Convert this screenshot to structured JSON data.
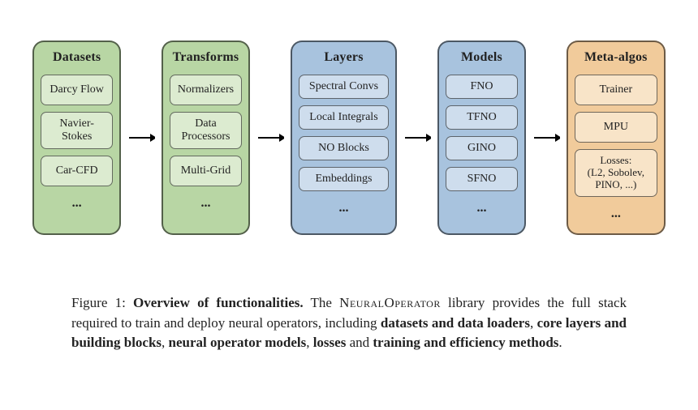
{
  "chart_data": {
    "type": "diagram",
    "flow": [
      "Datasets",
      "Transforms",
      "Layers",
      "Models",
      "Meta-algos"
    ],
    "columns": [
      {
        "title": "Datasets",
        "color": "green",
        "items": [
          "Darcy Flow",
          "Navier-Stokes",
          "Car-CFD"
        ],
        "more": "..."
      },
      {
        "title": "Transforms",
        "color": "green",
        "items": [
          "Normalizers",
          "Data Processors",
          "Multi-Grid"
        ],
        "more": "..."
      },
      {
        "title": "Layers",
        "color": "blue",
        "items": [
          "Spectral Convs",
          "Local Integrals",
          "NO Blocks",
          "Embeddings"
        ],
        "more": "..."
      },
      {
        "title": "Models",
        "color": "blue",
        "items": [
          "FNO",
          "TFNO",
          "GINO",
          "SFNO"
        ],
        "more": "..."
      },
      {
        "title": "Meta-algos",
        "color": "orange",
        "items": [
          "Trainer",
          "MPU",
          "Losses:\n(L2, Sobolev, PINO, ...)"
        ],
        "more": "..."
      }
    ]
  },
  "caption": {
    "label": "Figure 1:",
    "title": "Overview of functionalities.",
    "text_before_lib": " The ",
    "library_name": "NeuralOperator",
    "text_mid": " library provides the full stack required to train and deploy neural operators, including ",
    "bold1": "datasets and data loaders",
    "sep1": ", ",
    "bold2": "core layers and building blocks",
    "sep2": ", ",
    "bold3": "neural operator models",
    "sep3": ", ",
    "bold4": "losses",
    "sep4": " and ",
    "bold5": "training and efficiency methods",
    "tail": "."
  }
}
